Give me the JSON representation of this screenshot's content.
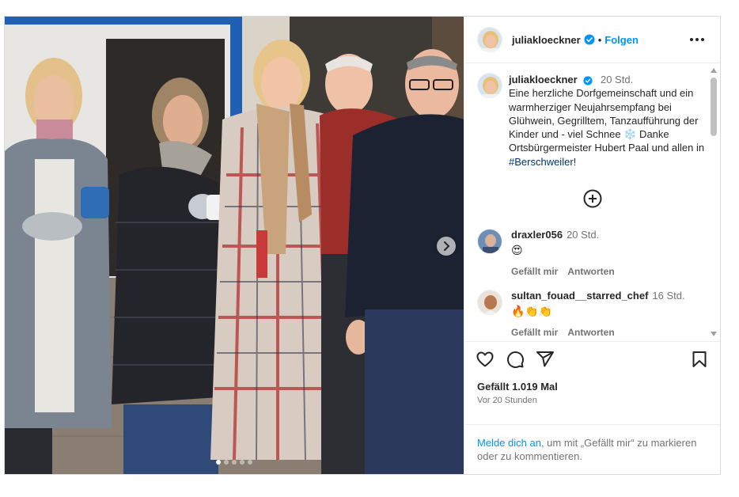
{
  "post": {
    "author": "juliakloeckner",
    "follow_label": "Folgen",
    "separator": "•",
    "caption_time": "20 Std.",
    "caption_text": "Eine herzliche Dorfgemeinschaft und ein warmherziger Neujahrsempfang bei Glühwein, Gegrilltem, Tanzaufführung der Kinder und - viel Schnee ❄️ Danke Ortsbürgermeister Hubert Paal und allen in ",
    "caption_hashtag": "#Berschweiler",
    "caption_end": "!",
    "likes": "Gefällt 1.019 Mal",
    "posted_ago": "Vor 20 Stunden",
    "carousel": {
      "slides": 5,
      "active": 0
    }
  },
  "comments": [
    {
      "user": "draxler056",
      "time": "20 Std.",
      "text": "😍",
      "like_label": "Gefällt mir",
      "reply_label": "Antworten"
    },
    {
      "user": "sultan_fouad__starred_chef",
      "time": "16 Std.",
      "text": "🔥👏👏",
      "like_label": "Gefällt mir",
      "reply_label": "Antworten"
    }
  ],
  "login": {
    "link": "Melde dich an",
    "rest": ", um mit „Gefällt mir“ zu markieren oder zu kommentieren."
  },
  "icons": {
    "verified": "verified-badge-icon",
    "more": "more-options-icon",
    "load_more": "plus-circle-icon",
    "like": "heart-icon",
    "comment": "comment-icon",
    "share": "share-icon",
    "save": "bookmark-icon",
    "next": "chevron-right-icon"
  },
  "colors": {
    "accent": "#0095f6",
    "verified": "#0095f6",
    "text": "#262626",
    "muted": "#737373"
  }
}
